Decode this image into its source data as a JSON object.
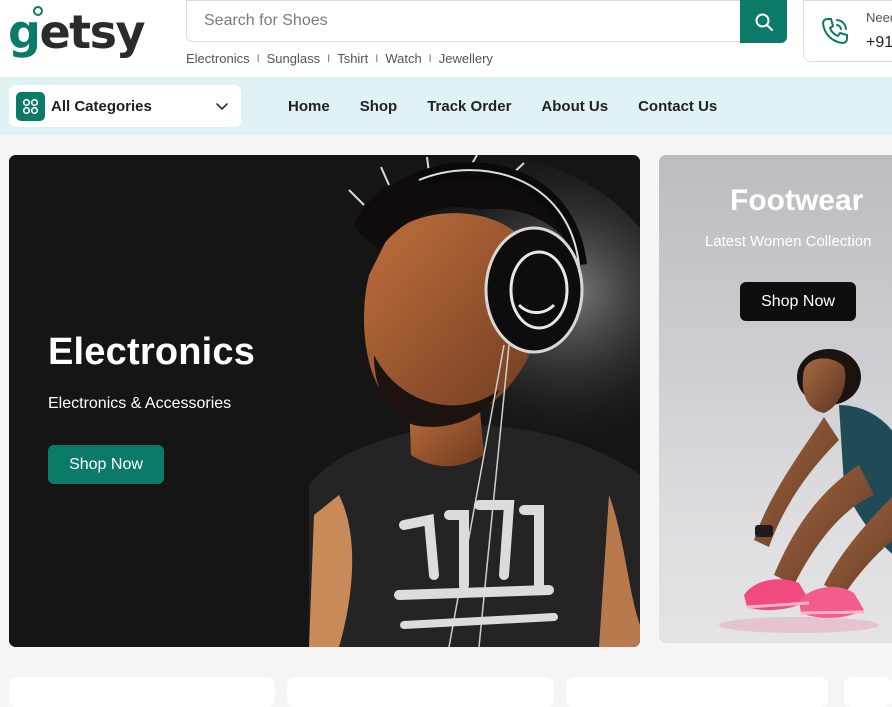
{
  "brand": {
    "name_prefix": "g",
    "name_rest": "etsy",
    "color": "#0c7a68"
  },
  "search": {
    "placeholder": "Search for Shoes",
    "icon": "search-icon"
  },
  "quick_links": [
    "Electronics",
    "Sunglass",
    "Tshirt",
    "Watch",
    "Jewellery"
  ],
  "quick_link_separator": "I",
  "contact": {
    "label": "Need",
    "number": "+91",
    "icon": "phone-icon"
  },
  "category_select": {
    "label": "All Categories",
    "icon": "grid-icon"
  },
  "nav": {
    "items": [
      "Home",
      "Shop",
      "Track Order",
      "About Us",
      "Contact Us"
    ]
  },
  "banners": {
    "main": {
      "title": "Electronics",
      "subtitle": "Electronics & Accessories",
      "button": "Shop Now"
    },
    "side": {
      "title": "Footwear",
      "subtitle": "Latest Women Collection",
      "button": "Shop Now"
    }
  },
  "colors": {
    "accent": "#0c7a68",
    "nav_bg": "#dff2f4",
    "page_bg": "#f4f5f4"
  }
}
